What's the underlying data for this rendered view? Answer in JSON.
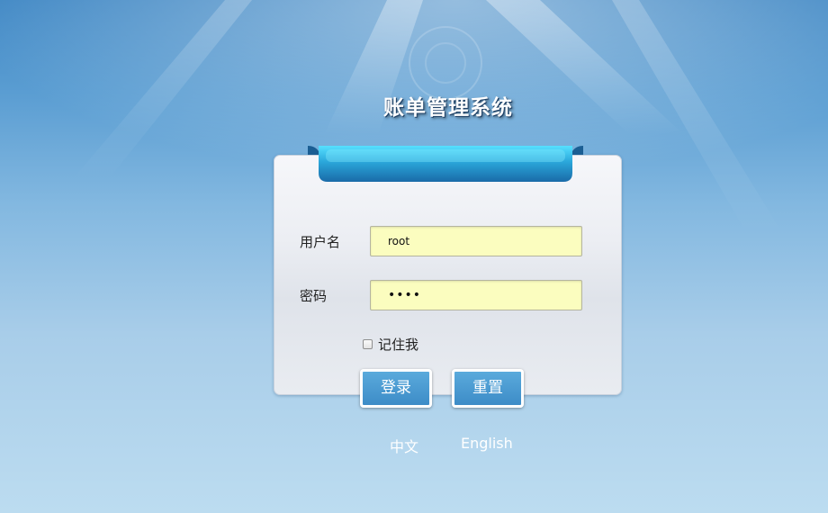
{
  "app_title": "账单管理系统",
  "login_form": {
    "username_label": "用户名",
    "username_value": "root",
    "password_label": "密码",
    "password_value": "••••",
    "remember_label": "记住我",
    "remember_checked": false,
    "login_button": "登录",
    "reset_button": "重置"
  },
  "languages": {
    "chinese": "中文",
    "english": "English"
  },
  "colors": {
    "field_background": "#fbfdbf",
    "button_blue": "#4a9bd2",
    "ribbon_cyan": "#4fd6f5"
  }
}
